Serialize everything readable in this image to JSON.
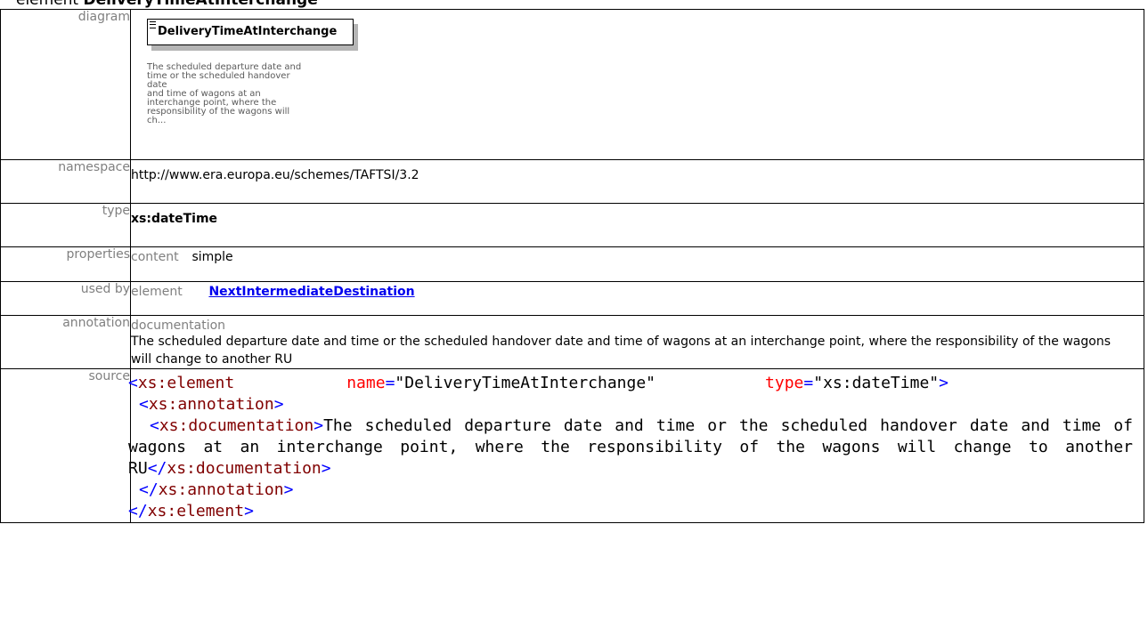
{
  "heading": {
    "kind": "element",
    "name": "DeliveryTimeAtInterchange"
  },
  "rows": {
    "diagram": {
      "label": "diagram",
      "box_title": "DeliveryTimeAtInterchange",
      "note_lines": [
        "The scheduled departure date and",
        "time or the scheduled handover date",
        "and time of wagons at an",
        "interchange point, where the",
        "responsibility of the wagons will ch..."
      ]
    },
    "namespace": {
      "label": "namespace",
      "value": "http://www.era.europa.eu/schemes/TAFTSI/3.2"
    },
    "type": {
      "label": "type",
      "value": "xs:dateTime"
    },
    "properties": {
      "label": "properties",
      "key": "content",
      "value": "simple"
    },
    "used_by": {
      "label": "used by",
      "key": "element",
      "link": "NextIntermediateDestination"
    },
    "annotation": {
      "label": "annotation",
      "key": "documentation",
      "text": "The scheduled departure date and time or the scheduled handover date and time of wagons at an interchange point, where the responsibility of the wagons will change to another RU"
    },
    "source": {
      "label": "source",
      "open_lt": "<",
      "close_lt": "</",
      "gt": ">",
      "element_tag": "xs:element",
      "attr_name": "name",
      "attr_name_eq": "=",
      "attr_name_val": "\"DeliveryTimeAtInterchange\"",
      "attr_type": "type",
      "attr_type_eq": "=",
      "attr_type_val": "\"xs:dateTime\"",
      "annotation_tag": "xs:annotation",
      "documentation_tag": "xs:documentation",
      "doc_text": "The scheduled departure date and time or the scheduled handover date and time of wagons at an interchange point, where the responsibility of the wagons will change to another RU"
    }
  }
}
